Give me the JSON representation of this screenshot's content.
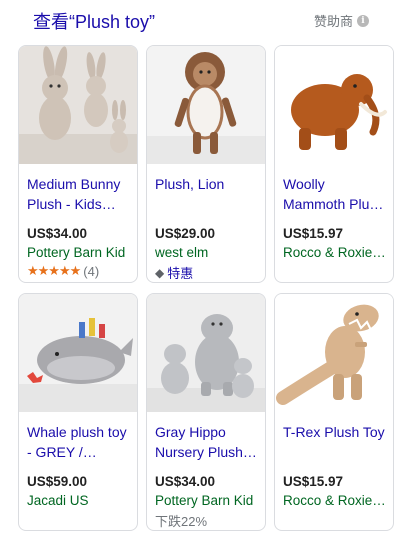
{
  "header": {
    "title": "查看“Plush toy”",
    "sponsored_label": "赞助商",
    "info_glyph": "i"
  },
  "products": [
    {
      "name": "Medium Bunny Plush - Kids…",
      "price": "US$34.00",
      "merchant": "Pottery Barn Kid",
      "rating_stars": "★★★★★",
      "rating_count": "(4)",
      "image_icon": "bunny-plush-icon"
    },
    {
      "name": "Plush, Lion",
      "price": "US$29.00",
      "merchant": "west elm",
      "badge": "特惠",
      "image_icon": "lion-plush-icon"
    },
    {
      "name": "Woolly Mammoth Plu…",
      "price": "US$15.97",
      "merchant": "Rocco & Roxie…",
      "image_icon": "mammoth-plush-icon"
    },
    {
      "name": "Whale plush toy - GREY /…",
      "price": "US$59.00",
      "merchant": "Jacadi US",
      "image_icon": "whale-plush-icon"
    },
    {
      "name": "Gray Hippo Nursery Plush…",
      "price": "US$34.00",
      "merchant": "Pottery Barn Kid",
      "price_drop": "下跌22%",
      "image_icon": "hippo-plush-icon"
    },
    {
      "name": "T-Rex Plush Toy",
      "price": "US$15.97",
      "merchant": "Rocco & Roxie…",
      "image_icon": "trex-plush-icon"
    }
  ],
  "colors": {
    "link": "#1a0dab",
    "merchant": "#006621",
    "star": "#e7711b",
    "border": "#dadce0"
  }
}
